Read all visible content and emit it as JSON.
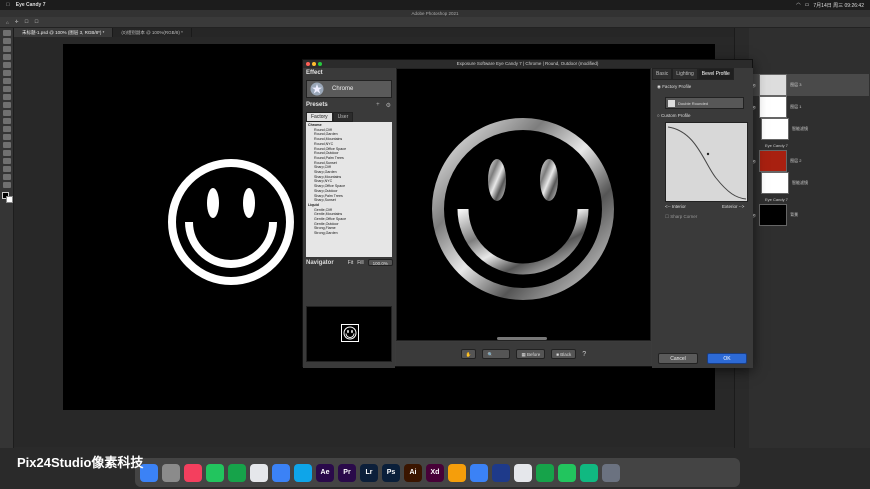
{
  "menubar": {
    "app_name": "Eye Candy 7",
    "datetime": "7月14日 周三 09:26:42"
  },
  "ps_title": "Adobe Photoshop 2021",
  "doc_tabs": [
    {
      "label": "未标题-1.psd @ 100% (图层 3, RGB/8*) *",
      "active": true
    },
    {
      "label": "(0)组别副本 @ 100%(RGB/8) *",
      "active": false
    }
  ],
  "dialog": {
    "title": "Exposure Software Eye Candy 7 | Chrome | Round, Outdoor (modified)",
    "effect_heading": "Effect",
    "effect_name": "Chrome",
    "presets_heading": "Presets",
    "preset_tabs": [
      "Factory",
      "User"
    ],
    "preset_list": [
      {
        "label": "Chrome",
        "group": true
      },
      {
        "label": "Round,Cliff",
        "group": false
      },
      {
        "label": "Round,Garden",
        "group": false
      },
      {
        "label": "Round,Mountains",
        "group": false
      },
      {
        "label": "Round,NYC",
        "group": false
      },
      {
        "label": "Round,Office Space",
        "group": false
      },
      {
        "label": "Round,Outdoor",
        "group": false
      },
      {
        "label": "Round,Palm Trees",
        "group": false
      },
      {
        "label": "Round,Sunset",
        "group": false
      },
      {
        "label": "Sharp,Cliff",
        "group": false
      },
      {
        "label": "Sharp,Garden",
        "group": false
      },
      {
        "label": "Sharp,Mountains",
        "group": false
      },
      {
        "label": "Sharp,NYC",
        "group": false
      },
      {
        "label": "Sharp,Office Space",
        "group": false
      },
      {
        "label": "Sharp,Outdoor",
        "group": false
      },
      {
        "label": "Sharp,Palm Trees",
        "group": false
      },
      {
        "label": "Sharp,Sunset",
        "group": false
      },
      {
        "label": "Liquid",
        "group": true
      },
      {
        "label": "Gentle,Cliff",
        "group": false
      },
      {
        "label": "Gentle,Mountains",
        "group": false
      },
      {
        "label": "Gentle,Office Space",
        "group": false
      },
      {
        "label": "Gentle,Outdoor",
        "group": false
      },
      {
        "label": "Strong,Flame",
        "group": false
      },
      {
        "label": "Strong,Garden",
        "group": false
      }
    ],
    "navigator_label": "Navigator",
    "nav_fit": "Fit",
    "nav_fill": "Fill",
    "nav_zoom": "100.0%",
    "right_tabs": [
      "Basic",
      "Lighting",
      "Bevel Profile"
    ],
    "factory_profile": "Factory Profile",
    "profile_select": "Double Rounded",
    "custom_profile": "Custom Profile",
    "interior_label": "<-- Interior",
    "exterior_label": "Exterior -->",
    "sharp_corner": "Sharp Corner",
    "before_label": "Before",
    "black_label": "Black",
    "cancel": "Cancel",
    "ok": "OK"
  },
  "layers": [
    {
      "name": "图层 3"
    },
    {
      "name": "图层 1"
    },
    {
      "name": "智能滤镜"
    },
    {
      "name": "Eye Candy 7"
    },
    {
      "name": "图层 2"
    },
    {
      "name": "智能滤镜"
    },
    {
      "name": "Eye Candy 7"
    },
    {
      "name": "背景"
    }
  ],
  "dock_apps": [
    "Finder",
    "Launchpad",
    "Music",
    "Messages",
    "WeChat",
    "Chrome",
    "Pixelmator",
    "Safari",
    "After Effects",
    "Premiere",
    "Lightroom",
    "Photoshop",
    "Illustrator",
    "XD",
    "Sketch",
    "Keynote",
    "Cinema 4D",
    "Chrome",
    "Xmind",
    "Numbers",
    "Maps",
    "Trash"
  ],
  "watermark": "Pix24Studio像素科技",
  "colors": {
    "accent": "#2d6ad6",
    "chrome_bg": "#3c3c3c",
    "preview_bg": "#000000"
  }
}
